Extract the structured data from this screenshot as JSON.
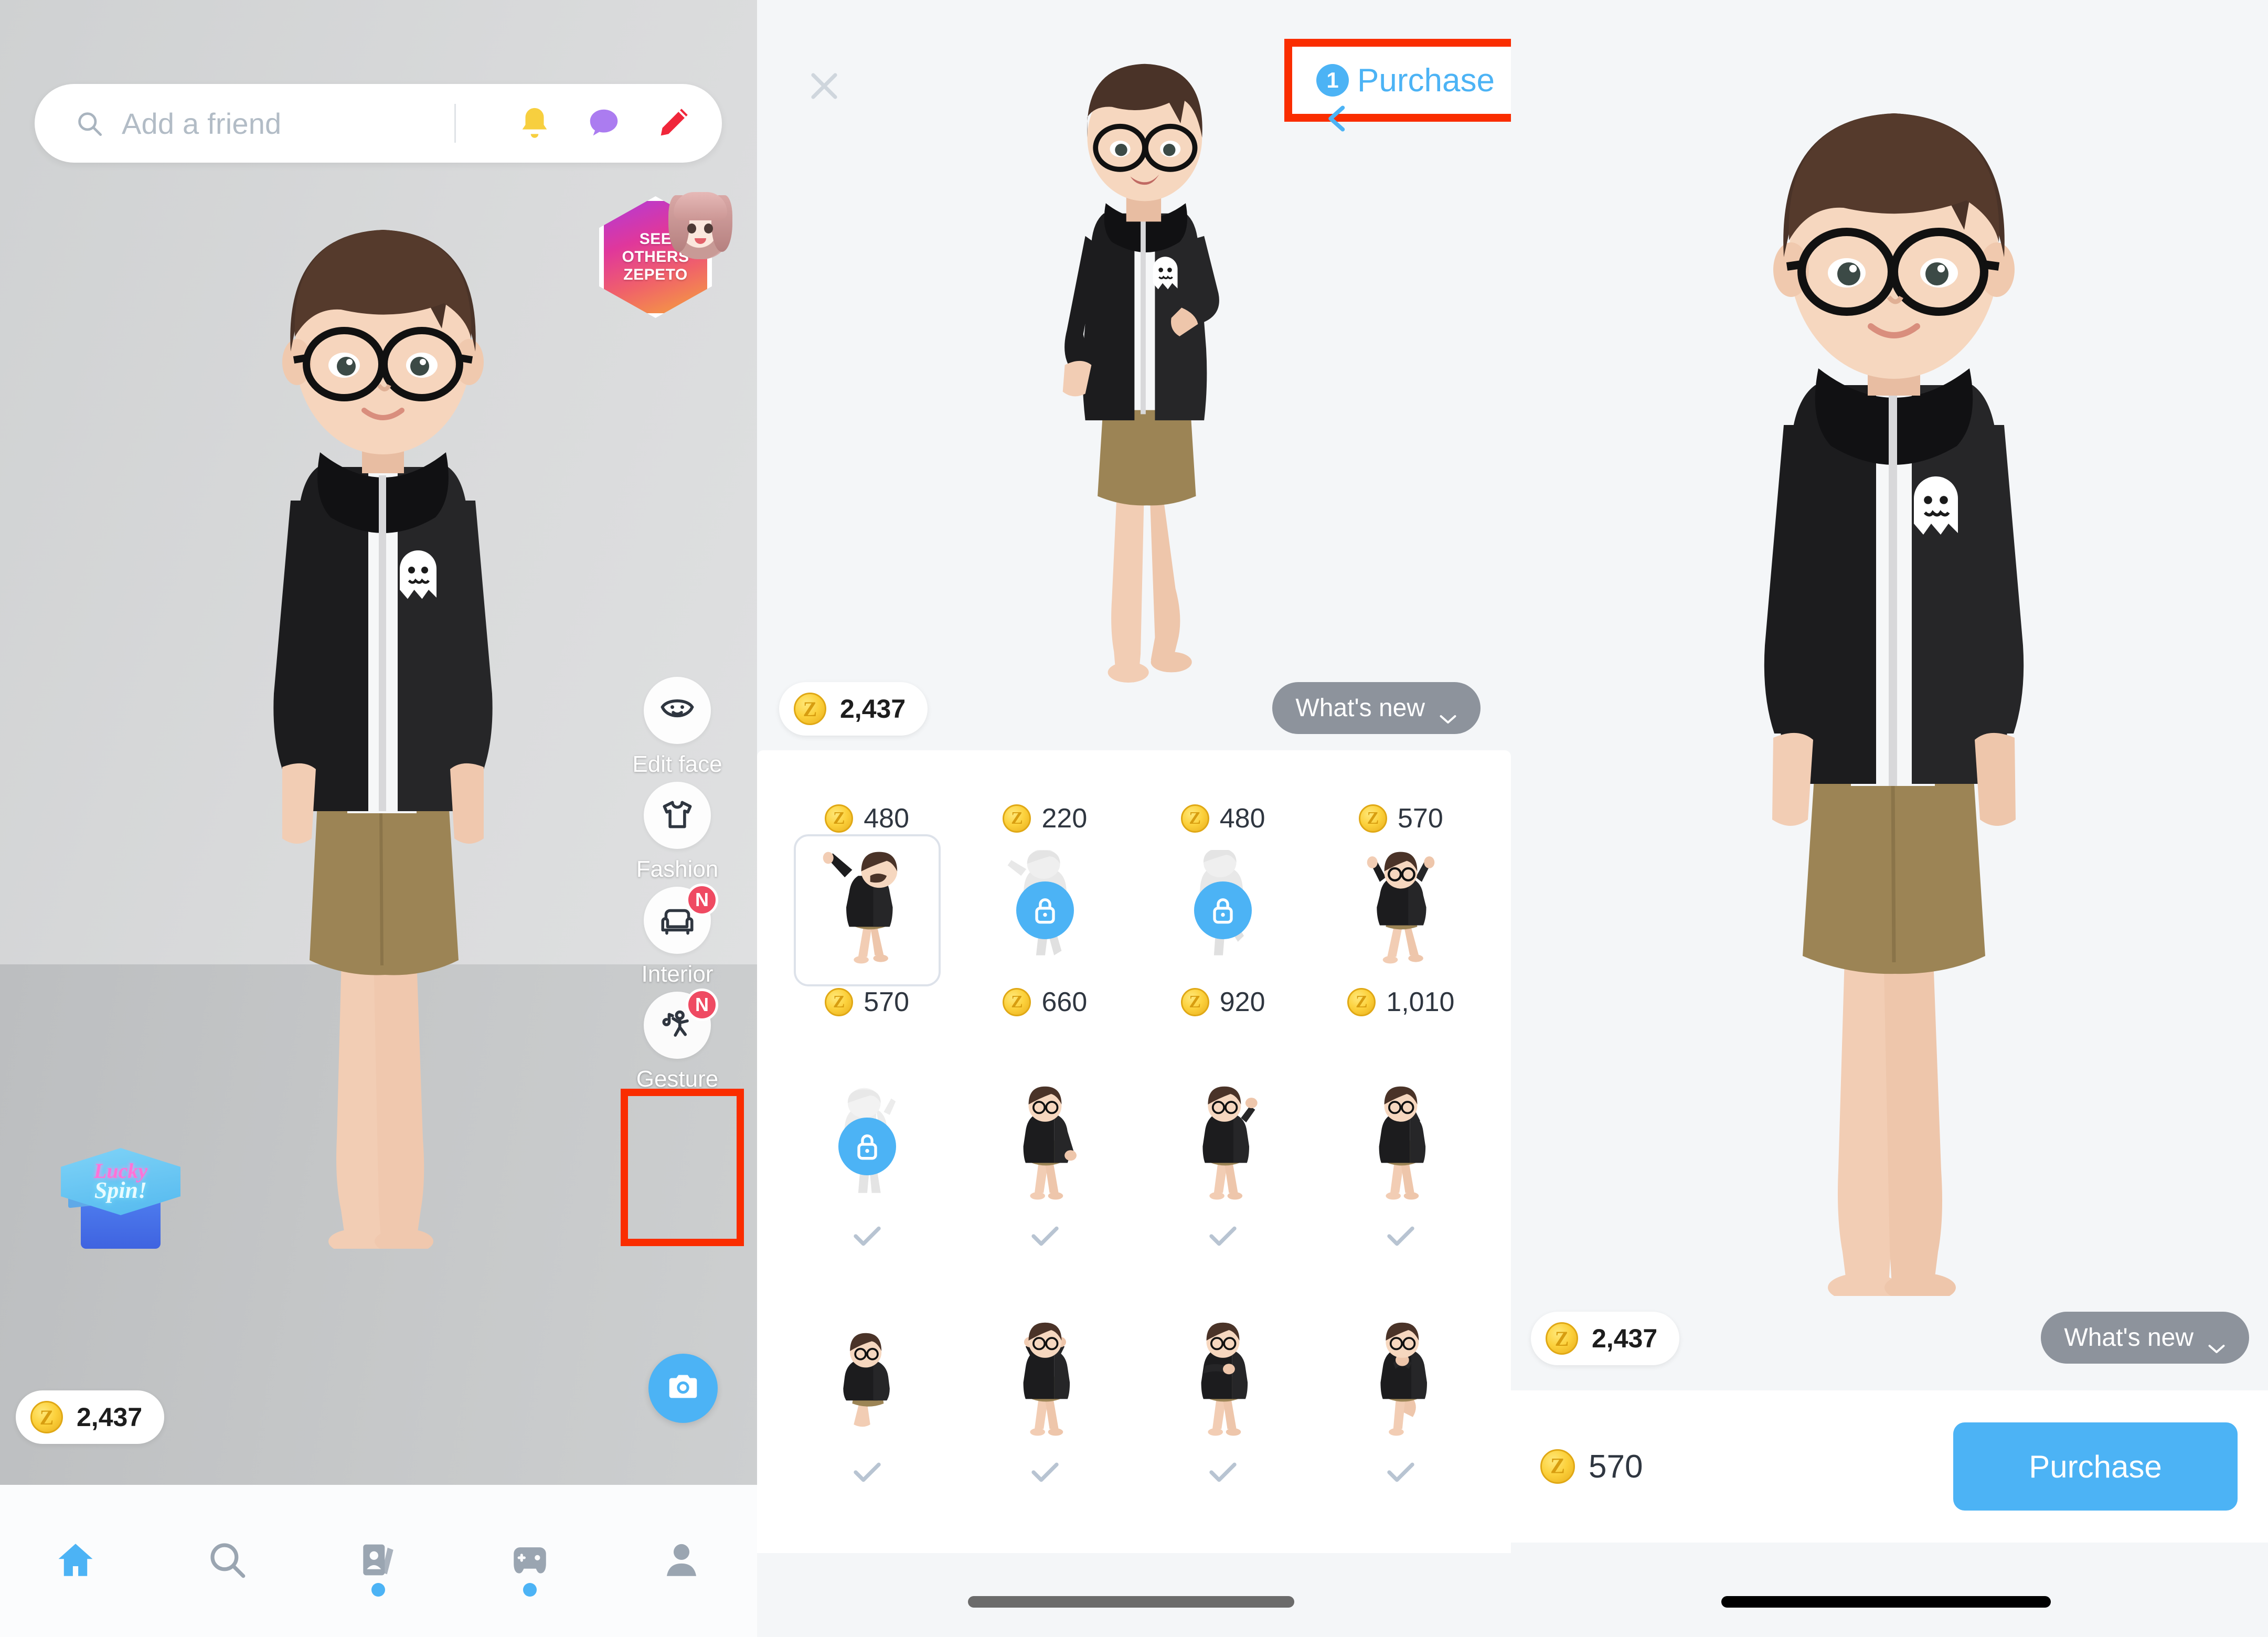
{
  "left": {
    "search": {
      "placeholder": "Add a friend",
      "icon": "search-icon"
    },
    "header_icons": [
      {
        "name": "bell-icon",
        "label": "Notifications"
      },
      {
        "name": "chat-bubble-icon",
        "label": "Messages"
      },
      {
        "name": "pencil-icon",
        "label": "Edit"
      }
    ],
    "zepeto_badge": {
      "line1": "SEE",
      "line2": "OTHERS",
      "line3": "ZEPETO"
    },
    "menu": [
      {
        "label": "Edit face",
        "icon": "face-icon",
        "badge": ""
      },
      {
        "label": "Fashion",
        "icon": "tshirt-icon",
        "badge": ""
      },
      {
        "label": "Interior",
        "icon": "sofa-icon",
        "badge": "N"
      },
      {
        "label": "Gesture",
        "icon": "gesture-icon",
        "badge": "N",
        "highlighted": true
      }
    ],
    "lucky_spin": {
      "line1": "Lucky",
      "line2": "Spin!"
    },
    "coin": {
      "symbol": "Z",
      "value": "2,437"
    },
    "camera_button": "camera-icon",
    "bottom_nav": [
      {
        "name": "home-icon",
        "active": true,
        "dot": false
      },
      {
        "name": "search-icon",
        "active": false,
        "dot": false
      },
      {
        "name": "feed-icon",
        "active": false,
        "dot": true
      },
      {
        "name": "game-controller-icon",
        "active": false,
        "dot": true
      },
      {
        "name": "profile-icon",
        "active": false,
        "dot": false
      }
    ]
  },
  "middle": {
    "close_label": "close-icon",
    "step_number": "1",
    "title": "Purchase",
    "back_label": "back-chevron-icon",
    "coin": {
      "symbol": "Z",
      "value": "2,437"
    },
    "whats_new": "What's new",
    "grid": {
      "top_row_prices": [
        "480",
        "220",
        "480",
        "570"
      ],
      "rows": [
        {
          "items": [
            {
              "state": "selected",
              "price": "570"
            },
            {
              "state": "locked",
              "price": "660"
            },
            {
              "state": "locked",
              "price": "920"
            },
            {
              "state": "available",
              "price": "1,010"
            }
          ]
        },
        {
          "items": [
            {
              "state": "locked",
              "price": "",
              "owned": true
            },
            {
              "state": "owned",
              "price": "",
              "owned": true
            },
            {
              "state": "owned",
              "price": "",
              "owned": true
            },
            {
              "state": "owned",
              "price": "",
              "owned": true
            }
          ]
        },
        {
          "items": [
            {
              "state": "owned",
              "price": "",
              "owned": true
            },
            {
              "state": "owned",
              "price": "",
              "owned": true
            },
            {
              "state": "owned",
              "price": "",
              "owned": true
            },
            {
              "state": "owned",
              "price": "",
              "owned": true
            }
          ]
        }
      ]
    }
  },
  "right": {
    "coin": {
      "symbol": "Z",
      "value": "2,437"
    },
    "whats_new": "What's new",
    "price": {
      "symbol": "Z",
      "value": "570"
    },
    "purchase_button": "Purchase"
  },
  "colors": {
    "accent_blue": "#4cb3f5",
    "highlight_red": "#fa2d00",
    "coin_gold": "#fcd13c",
    "badge_red": "#ef4a62",
    "whatsnew_gray": "#8d939c"
  }
}
